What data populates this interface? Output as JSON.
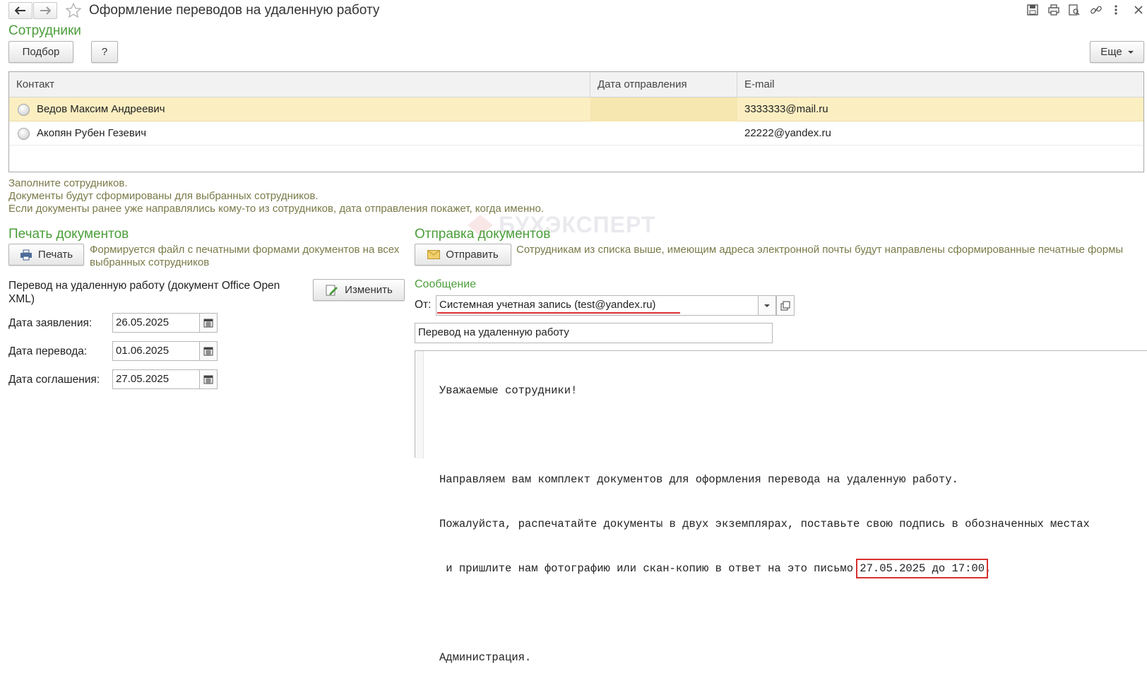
{
  "window": {
    "title": "Оформление переводов на удаленную работу"
  },
  "employees": {
    "heading": "Сотрудники",
    "select_button": "Подбор",
    "help_button": "?",
    "more_button": "Еще",
    "columns": [
      "Контакт",
      "Дата отправления",
      "E-mail"
    ],
    "rows": [
      {
        "contact": "Ведов Максим Андреевич",
        "date": "",
        "email": "3333333@mail.ru",
        "selected": true
      },
      {
        "contact": "Акопян Рубен Гезевич",
        "date": "",
        "email": "22222@yandex.ru",
        "selected": false
      }
    ],
    "hint_lines": [
      "Заполните сотрудников.",
      "Документы будут сформированы для выбранных сотрудников.",
      "Если документы ранее уже направлялись кому-то из сотрудников, дата отправления покажет, когда именно."
    ]
  },
  "watermark": "БУХЭКСПЕРТ",
  "print_section": {
    "heading": "Печать документов",
    "print_button": "Печать",
    "print_hint": "Формируется файл с печатными формами документов на всех выбранных сотрудников",
    "document_label": "Перевод на удаленную работу (документ Office Open XML)",
    "edit_button": "Изменить",
    "fields": [
      {
        "label": "Дата заявления:",
        "value": "26.05.2025"
      },
      {
        "label": "Дата перевода:",
        "value": "01.06.2025"
      },
      {
        "label": "Дата соглашения:",
        "value": "27.05.2025"
      }
    ]
  },
  "send_section": {
    "heading": "Отправка документов",
    "send_button": "Отправить",
    "send_hint": "Сотрудникам из списка выше, имеющим адреса электронной почты будут направлены сформированные печатные формы",
    "message_heading": "Сообщение",
    "from_label": "От:",
    "from_value": "Системная учетная запись (test@yandex.ru)",
    "subject": "Перевод на удаленную работу",
    "body": {
      "greeting": "Уважаемые сотрудники!",
      "line1": "Направляем вам комплект документов для оформления перевода на удаленную работу.",
      "line2": "Пожалуйста, распечатайте документы в двух экземплярах, поставьте свою подпись в обозначенных местах",
      "line3_prefix": " и пришлите нам фотографию или скан-копию в ответ на это письмо ",
      "line3_deadline": "27.05.2025 до 17:00",
      "line3_suffix": ".",
      "signature": "Администрация."
    }
  },
  "colors": {
    "accent_green": "#4b9e3a",
    "selected_row": "#fbefc2",
    "annotation_red": "#d93030",
    "hint_text": "#7a7a49"
  }
}
